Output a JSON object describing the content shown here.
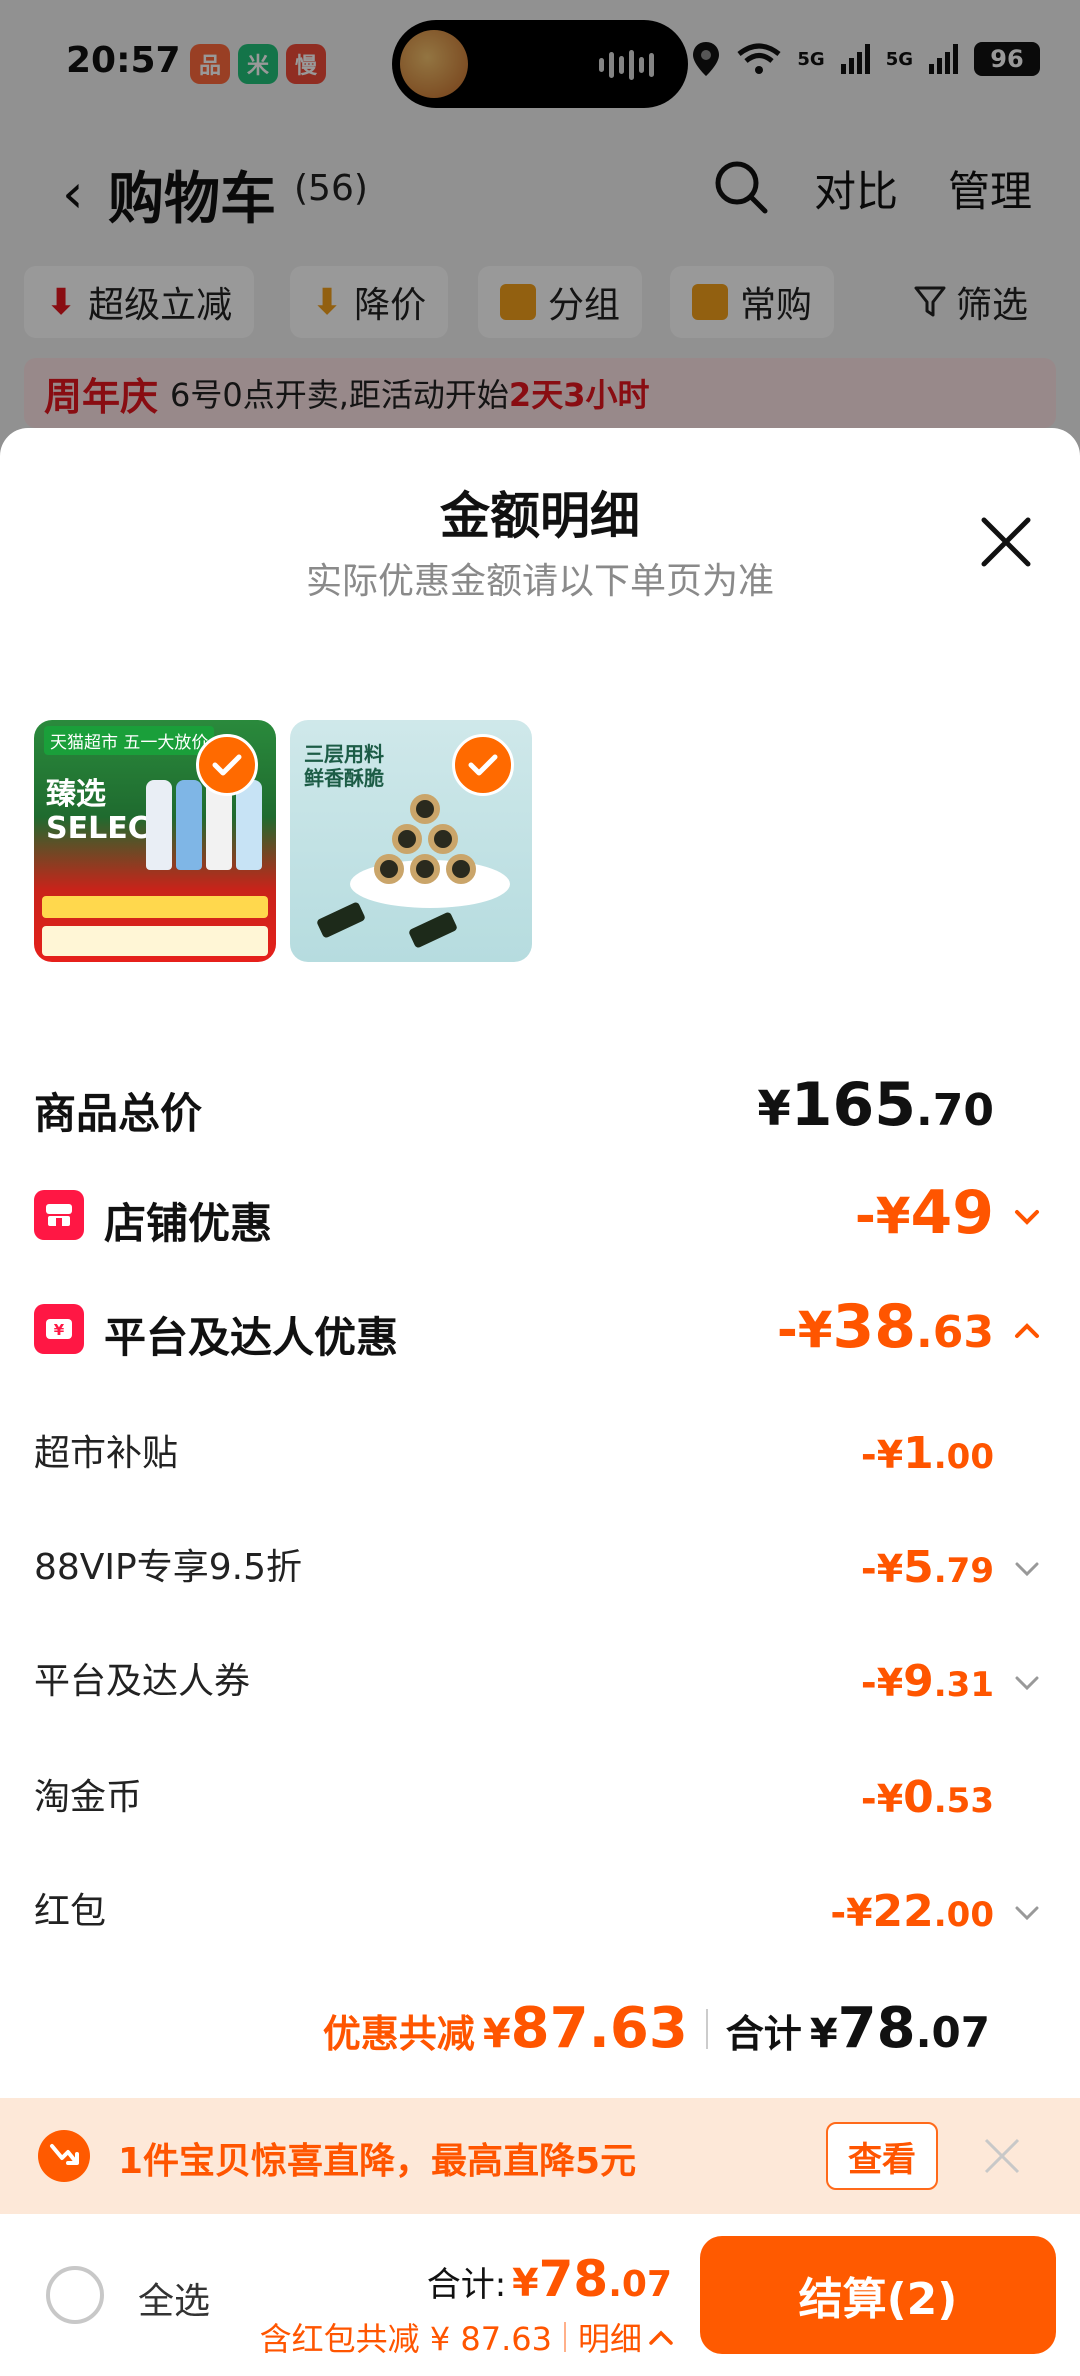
{
  "status_bar": {
    "time": "20:57",
    "app_badges": [
      {
        "name": "app-badge-1",
        "glyph": "品",
        "color": "#ff6a3d"
      },
      {
        "name": "app-badge-2",
        "glyph": "米",
        "color": "#22c27a"
      },
      {
        "name": "app-badge-3",
        "glyph": "慢",
        "color": "#f04b3a"
      }
    ],
    "network_1": "5G",
    "network_2": "5G",
    "battery": "96"
  },
  "cart_header": {
    "title": "购物车",
    "count": "(56)",
    "compare_label": "对比",
    "manage_label": "管理"
  },
  "chips": [
    {
      "label": "超级立减",
      "icon_color": "#e4161f"
    },
    {
      "label": "降价",
      "icon_color": "#f4a11b"
    },
    {
      "label": "分组",
      "icon_color": "#f4a11b"
    },
    {
      "label": "常购",
      "icon_color": "#f4a11b"
    }
  ],
  "filter_label": "筛选",
  "promo_strip": {
    "tag": "周年庆",
    "text": "6号0点开卖,距活动开始",
    "countdown": "2天3小时"
  },
  "sheet": {
    "title": "金额明细",
    "subtitle": "实际优惠金额请以下单页为准",
    "products": [
      {
        "name": "product-thumb-beer",
        "banner": "天猫超市 五一大放价",
        "headline": "臻选 SELECT"
      },
      {
        "name": "product-thumb-seaweed",
        "headline": "三层用料 鲜香酥脆"
      }
    ],
    "rows": {
      "total_price": {
        "label": "商品总价",
        "currency": "¥",
        "int": "165",
        "dec": ".70"
      },
      "store_discount": {
        "label": "店铺优惠",
        "currency": "-¥",
        "int": "49",
        "dec": ""
      },
      "platform_discount": {
        "label": "平台及达人优惠",
        "currency": "-¥",
        "int": "38",
        "dec": ".63"
      },
      "supermarket_subsidy": {
        "label": "超市补贴",
        "currency": "-¥",
        "int": "1",
        "dec": ".00"
      },
      "vip_discount": {
        "label": "88VIP专享9.5折",
        "currency": "-¥",
        "int": "5",
        "dec": ".79"
      },
      "platform_coupon": {
        "label": "平台及达人券",
        "currency": "-¥",
        "int": "9",
        "dec": ".31"
      },
      "taojin_coin": {
        "label": "淘金币",
        "currency": "-¥",
        "int": "0",
        "dec": ".53"
      },
      "red_packet": {
        "label": "红包",
        "currency": "-¥",
        "int": "22",
        "dec": ".00"
      }
    },
    "summary": {
      "saving_label": "优惠共减",
      "saving_currency": "¥",
      "saving_value": "87.63",
      "total_label": "合计",
      "total_currency": "¥",
      "total_int": "78",
      "total_dec": ".07"
    }
  },
  "drop_banner": {
    "text": "1件宝贝惊喜直降，最高直降5元",
    "view_label": "查看"
  },
  "bottom_bar": {
    "select_all": "全选",
    "total_label": "合计:",
    "total_currency": "¥",
    "total_int": "78",
    "total_dec": ".07",
    "detail_text": "含红包共减 ¥ 87.63",
    "detail_link": "明细",
    "checkout_label": "结算(2)"
  },
  "colors": {
    "accent": "#ff5500",
    "checkout": "#ff5a00",
    "promo_red": "#e4161f"
  }
}
